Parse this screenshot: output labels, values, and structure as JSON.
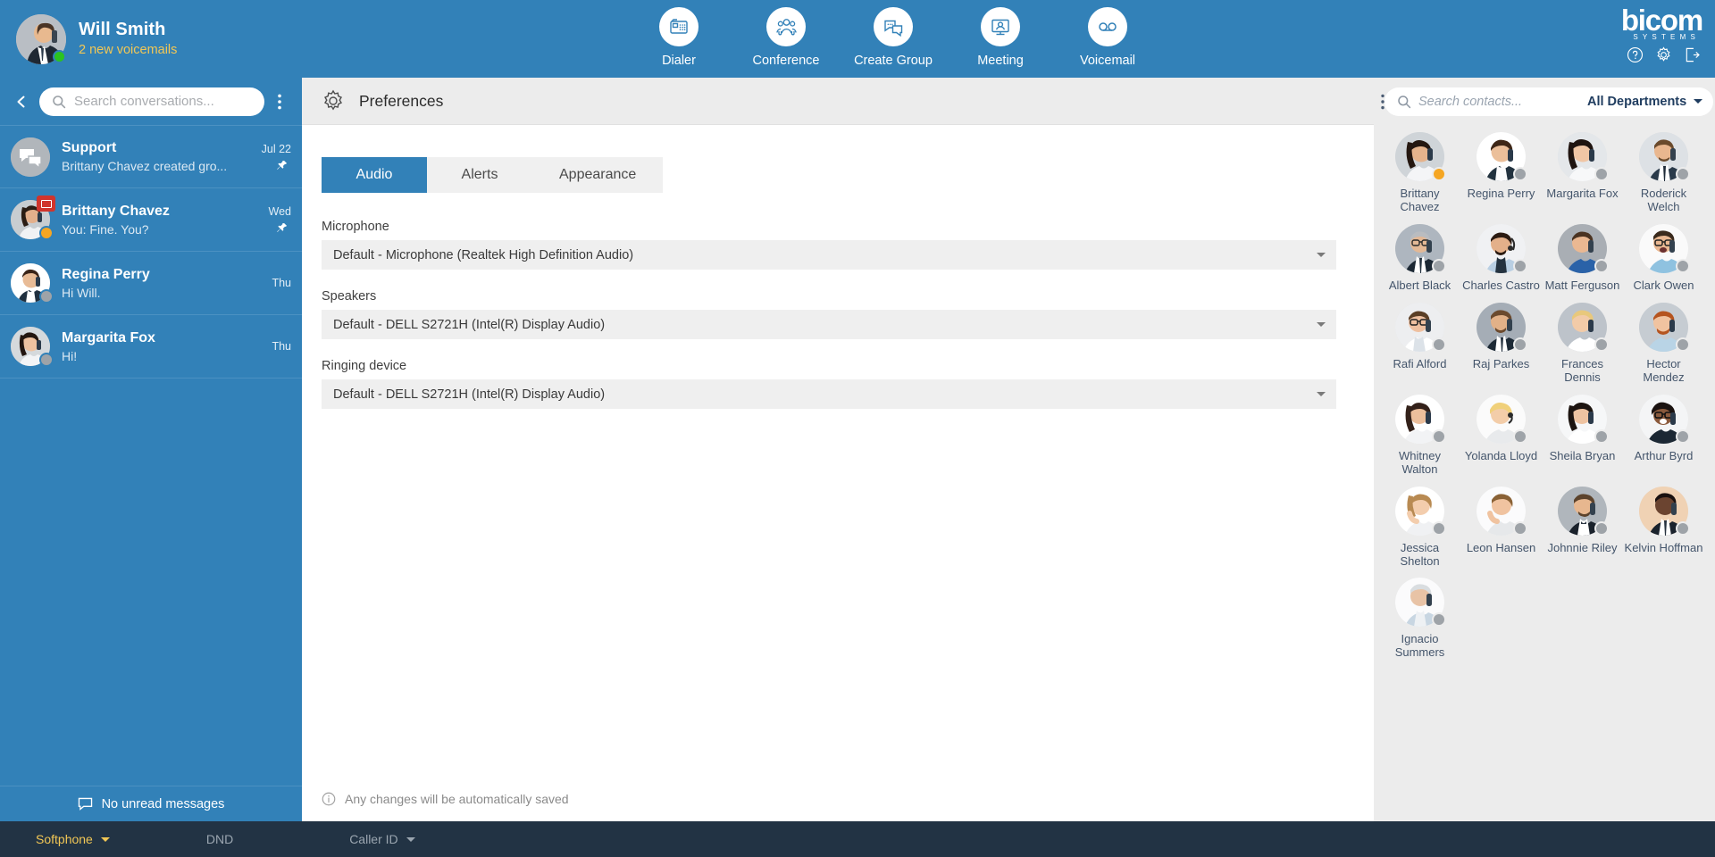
{
  "colors": {
    "brand_blue": "#3281b8",
    "sidebar_blue": "#3281b8",
    "accent_gold": "#f2c755",
    "away_orange": "#f5a623",
    "online_green": "#2bc320",
    "unread_red": "#d0342c",
    "bottom_bar": "#223344",
    "panel_grey": "#ececec"
  },
  "topbar": {
    "user": {
      "name": "Will Smith",
      "subtitle": "2 new voicemails",
      "presence": "online",
      "avatar_icon": "user-avatar"
    },
    "nav": [
      {
        "label": "Dialer",
        "icon": "dialer-icon"
      },
      {
        "label": "Conference",
        "icon": "conference-icon"
      },
      {
        "label": "Create Group",
        "icon": "create-group-icon"
      },
      {
        "label": "Meeting",
        "icon": "meeting-icon"
      },
      {
        "label": "Voicemail",
        "icon": "voicemail-icon"
      }
    ],
    "brand": {
      "name": "bicom",
      "tagline": "SYSTEMS"
    },
    "brand_actions": [
      {
        "name": "help-icon"
      },
      {
        "name": "settings-icon"
      },
      {
        "name": "logout-icon"
      }
    ]
  },
  "sidebar": {
    "back_icon": "chevron-left-icon",
    "menu_icon": "kebab-menu-icon",
    "search": {
      "placeholder": "Search conversations...",
      "value": "",
      "icon": "search-icon"
    },
    "conversations": [
      {
        "title": "Support",
        "message": "Brittany Chavez created gro...",
        "time": "Jul 22",
        "pinned": true,
        "avatar_icon": "group-chat-icon",
        "presence": "none",
        "unread": false
      },
      {
        "title": "Brittany Chavez",
        "message": "You: Fine. You?",
        "time": "Wed",
        "pinned": true,
        "avatar_icon": "contact-avatar",
        "presence": "away",
        "unread": true
      },
      {
        "title": "Regina Perry",
        "message": "Hi Will.",
        "time": "Thu",
        "pinned": false,
        "avatar_icon": "contact-avatar",
        "presence": "offline",
        "unread": false
      },
      {
        "title": "Margarita Fox",
        "message": "Hi!",
        "time": "Thu",
        "pinned": false,
        "avatar_icon": "contact-avatar",
        "presence": "offline",
        "unread": false
      }
    ],
    "footer": {
      "label": "No unread messages",
      "icon": "message-icon"
    }
  },
  "preferences": {
    "header": {
      "title": "Preferences",
      "icon": "gear-icon"
    },
    "tabs": [
      {
        "label": "Audio",
        "active": true
      },
      {
        "label": "Alerts",
        "active": false
      },
      {
        "label": "Appearance",
        "active": false
      }
    ],
    "fields": [
      {
        "label": "Microphone",
        "value": "Default - Microphone (Realtek High Definition Audio)"
      },
      {
        "label": "Speakers",
        "value": "Default - DELL S2721H (Intel(R) Display Audio)"
      },
      {
        "label": "Ringing device",
        "value": "Default - DELL S2721H (Intel(R) Display Audio)"
      }
    ],
    "footer_note": {
      "text": "Any changes will be automatically saved",
      "icon": "info-icon"
    }
  },
  "contacts_panel": {
    "menu_icon": "kebab-menu-icon",
    "search": {
      "placeholder": "Search contacts...",
      "value": "",
      "icon": "search-icon"
    },
    "department_filter": "All Departments",
    "next_icon": "chevron-right-icon",
    "contacts": [
      {
        "name": "Brittany Chavez",
        "presence": "away"
      },
      {
        "name": "Regina Perry",
        "presence": "offline"
      },
      {
        "name": "Margarita Fox",
        "presence": "offline"
      },
      {
        "name": "Roderick Welch",
        "presence": "offline"
      },
      {
        "name": "Albert Black",
        "presence": "offline"
      },
      {
        "name": "Charles Castro",
        "presence": "offline"
      },
      {
        "name": "Matt Ferguson",
        "presence": "offline"
      },
      {
        "name": "Clark Owen",
        "presence": "offline"
      },
      {
        "name": "Rafi Alford",
        "presence": "offline"
      },
      {
        "name": "Raj Parkes",
        "presence": "offline"
      },
      {
        "name": "Frances Dennis",
        "presence": "offline"
      },
      {
        "name": "Hector Mendez",
        "presence": "offline"
      },
      {
        "name": "Whitney Walton",
        "presence": "offline"
      },
      {
        "name": "Yolanda Lloyd",
        "presence": "offline"
      },
      {
        "name": "Sheila Bryan",
        "presence": "offline"
      },
      {
        "name": "Arthur Byrd",
        "presence": "offline"
      },
      {
        "name": "Jessica Shelton",
        "presence": "offline"
      },
      {
        "name": "Leon Hansen",
        "presence": "offline"
      },
      {
        "name": "Johnnie Riley",
        "presence": "offline"
      },
      {
        "name": "Kelvin Hoffman",
        "presence": "offline"
      },
      {
        "name": "Ignacio Summers",
        "presence": "offline"
      }
    ]
  },
  "bottombar": {
    "softphone": "Softphone",
    "dnd": "DND",
    "caller_id": "Caller ID"
  }
}
